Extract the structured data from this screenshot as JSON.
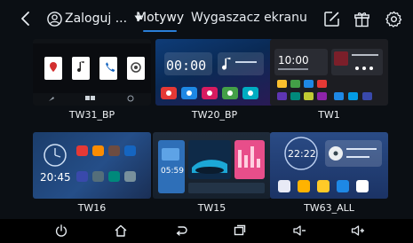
{
  "header": {
    "back_icon": "chevron-left-icon",
    "account_icon": "person-circle-icon",
    "account_label": "Zaloguj ...",
    "account_caret": "caret-down-icon",
    "tabs": [
      {
        "label": "Motywy",
        "active": true
      },
      {
        "label": "Wygaszacz ekranu",
        "active": false
      }
    ],
    "actions": [
      "edit-icon",
      "gift-icon",
      "settings-icon"
    ]
  },
  "themes": [
    {
      "name": "TW31_BP"
    },
    {
      "name": "TW20_BP",
      "clock": "00:00"
    },
    {
      "name": "TW1",
      "clock": "10:00"
    },
    {
      "name": "TW16",
      "clock": "20:45"
    },
    {
      "name": "TW15",
      "clock": "05:59"
    },
    {
      "name": "TW63_ALL",
      "clock": "22:22"
    }
  ],
  "bottom_nav": [
    "power-icon",
    "home-icon",
    "back-icon",
    "recent-apps-icon",
    "volume-down-icon",
    "volume-up-icon"
  ],
  "colors": {
    "accent": "#2a7ed8",
    "background": "#0b0f14",
    "bottom_bar": "#000000"
  }
}
